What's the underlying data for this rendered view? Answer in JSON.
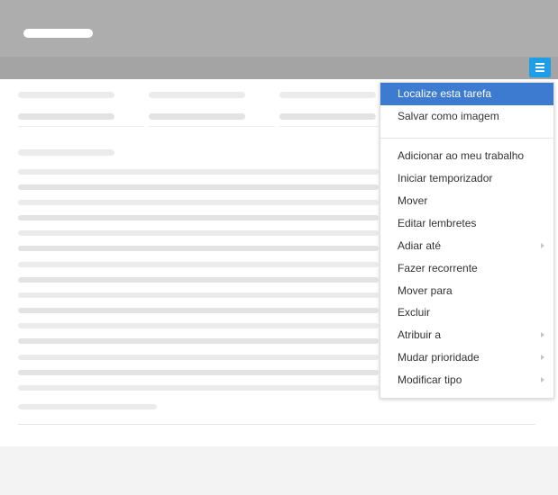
{
  "header": {
    "menu_toggle_icon": "hamburger-icon",
    "accent_color": "#1d9ee6"
  },
  "context_menu": {
    "highlight_color": "#3d7bd0",
    "submenu_icon": "chevron-right-icon",
    "items": [
      {
        "label": "Localize esta tarefa",
        "active": true,
        "has_submenu": false
      },
      {
        "label": "Salvar como imagem",
        "active": false,
        "has_submenu": false
      },
      {
        "label": "Adicionar ao meu trabalho",
        "active": false,
        "has_submenu": false
      },
      {
        "label": "Iniciar temporizador",
        "active": false,
        "has_submenu": false
      },
      {
        "label": "Mover",
        "active": false,
        "has_submenu": false
      },
      {
        "label": "Editar lembretes",
        "active": false,
        "has_submenu": false
      },
      {
        "label": "Adiar até",
        "active": false,
        "has_submenu": true
      },
      {
        "label": "Fazer recorrente",
        "active": false,
        "has_submenu": false
      },
      {
        "label": "Mover para",
        "active": false,
        "has_submenu": false
      },
      {
        "label": "Excluir",
        "active": false,
        "has_submenu": false
      },
      {
        "label": "Atribuir a",
        "active": false,
        "has_submenu": true
      },
      {
        "label": "Mudar prioridade",
        "active": false,
        "has_submenu": true
      },
      {
        "label": "Modificar tipo",
        "active": false,
        "has_submenu": true
      }
    ]
  }
}
